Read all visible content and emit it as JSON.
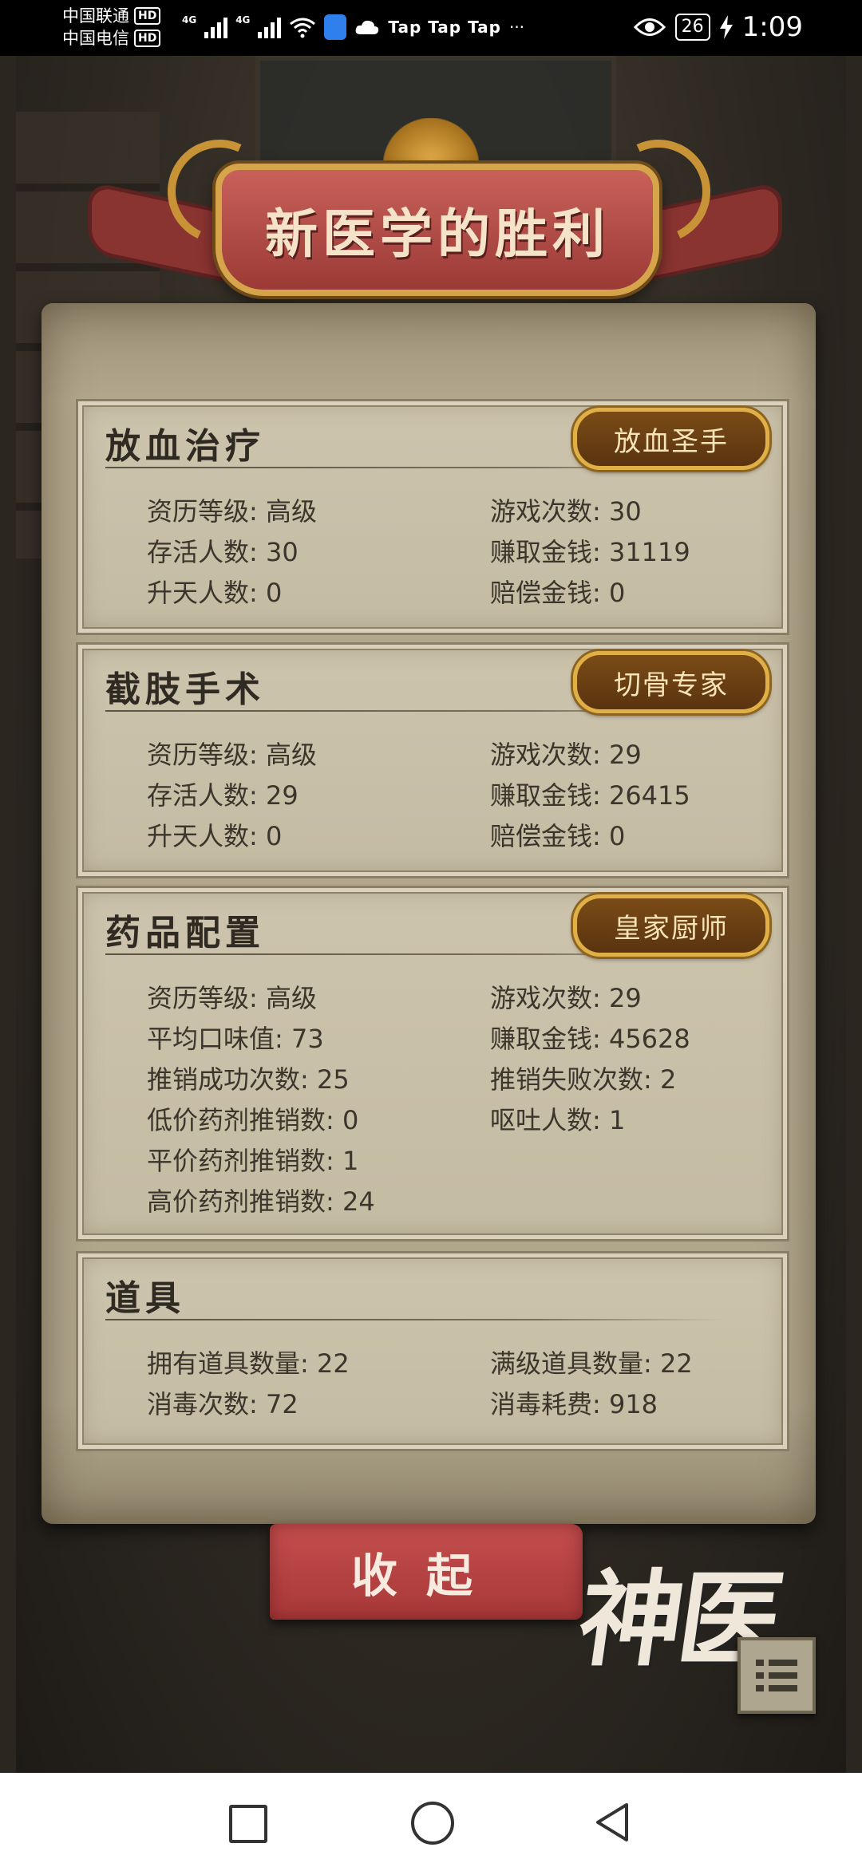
{
  "status_bar": {
    "carrier1": "中国联通",
    "carrier2": "中国电信",
    "hd": "HD",
    "network": "4G",
    "notification": "Tap Tap Tap",
    "more": "···",
    "battery": "26",
    "time": "1:09"
  },
  "title": "新医学的胜利",
  "sections": [
    {
      "title": "放血治疗",
      "badge": "放血圣手",
      "rows": [
        [
          "资历等级: 高级",
          "游戏次数: 30"
        ],
        [
          "存活人数: 30",
          "赚取金钱: 31119"
        ],
        [
          "升天人数: 0",
          "赔偿金钱: 0"
        ]
      ]
    },
    {
      "title": "截肢手术",
      "badge": "切骨专家",
      "rows": [
        [
          "资历等级: 高级",
          "游戏次数: 29"
        ],
        [
          "存活人数: 29",
          "赚取金钱: 26415"
        ],
        [
          "升天人数: 0",
          "赔偿金钱: 0"
        ]
      ]
    },
    {
      "title": "药品配置",
      "badge": "皇家厨师",
      "rows": [
        [
          "资历等级: 高级",
          "游戏次数: 29"
        ],
        [
          "平均口味值: 73",
          "赚取金钱: 45628"
        ],
        [
          "推销成功次数: 25",
          "推销失败次数: 2"
        ],
        [
          "低价药剂推销数: 0",
          "呕吐人数: 1"
        ],
        [
          "平价药剂推销数: 1",
          ""
        ],
        [
          "高价药剂推销数: 24",
          ""
        ]
      ]
    },
    {
      "title": "道具",
      "badge": "",
      "rows": [
        [
          "拥有道具数量: 22",
          "满级道具数量: 22"
        ],
        [
          "消毒次数: 72",
          "消毒耗费: 918"
        ]
      ]
    }
  ],
  "close_button": "收起",
  "logo_text": "神医",
  "icons": {
    "menu": "menu-list-icon",
    "nav_recent": "square-icon",
    "nav_home": "circle-icon",
    "nav_back": "back-triangle-icon"
  },
  "colors": {
    "banner": "#9b3a36",
    "button": "#a83838",
    "parchment": "#c4bba3",
    "badge_border": "#e0b046"
  }
}
